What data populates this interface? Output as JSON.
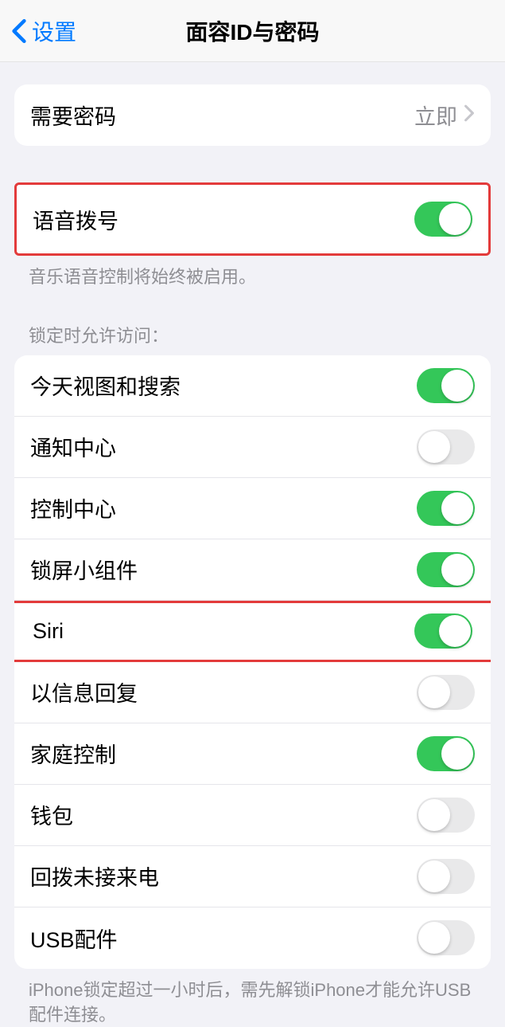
{
  "nav": {
    "back_label": "设置",
    "title": "面容ID与密码"
  },
  "require_passcode": {
    "label": "需要密码",
    "value": "立即"
  },
  "voice_dial": {
    "label": "语音拨号",
    "on": true,
    "footer": "音乐语音控制将始终被启用。"
  },
  "lock_access": {
    "header": "锁定时允许访问：",
    "items": [
      {
        "label": "今天视图和搜索",
        "on": true,
        "highlight": false
      },
      {
        "label": "通知中心",
        "on": false,
        "highlight": false
      },
      {
        "label": "控制中心",
        "on": true,
        "highlight": false
      },
      {
        "label": "锁屏小组件",
        "on": true,
        "highlight": false
      },
      {
        "label": "Siri",
        "on": true,
        "highlight": true
      },
      {
        "label": "以信息回复",
        "on": false,
        "highlight": false
      },
      {
        "label": "家庭控制",
        "on": true,
        "highlight": false
      },
      {
        "label": "钱包",
        "on": false,
        "highlight": false
      },
      {
        "label": "回拨未接来电",
        "on": false,
        "highlight": false
      },
      {
        "label": "USB配件",
        "on": false,
        "highlight": false
      }
    ],
    "footer": "iPhone锁定超过一小时后，需先解锁iPhone才能允许USB配件连接。"
  }
}
